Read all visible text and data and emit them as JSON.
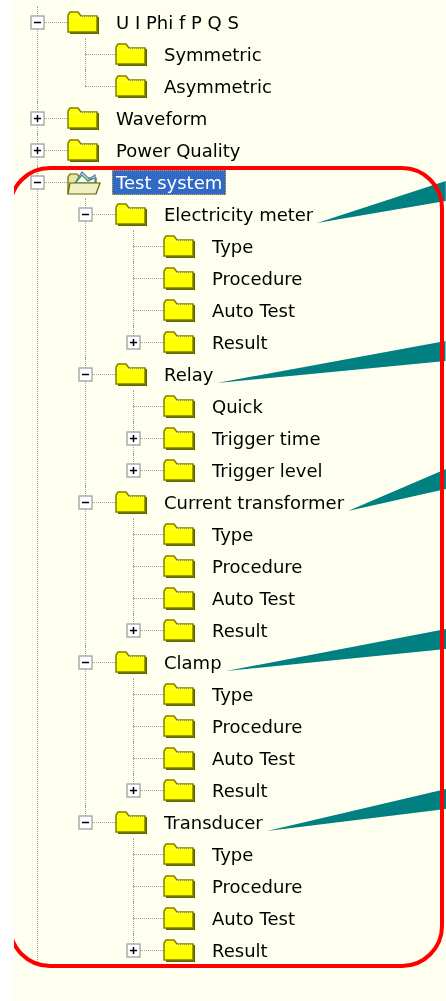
{
  "tree": [
    {
      "label": "U I Phi f P Q S",
      "kind": "folder",
      "selected": false,
      "expanded": true,
      "children": [
        {
          "label": "Symmetric",
          "kind": "folder",
          "selected": false
        },
        {
          "label": "Asymmetric",
          "kind": "folder",
          "selected": false
        }
      ]
    },
    {
      "label": "Waveform",
      "kind": "folder",
      "selected": false,
      "expanded": false
    },
    {
      "label": "Power Quality",
      "kind": "folder",
      "selected": false,
      "expanded": false
    },
    {
      "label": "Test system",
      "kind": "system",
      "selected": true,
      "expanded": true,
      "framed": true,
      "children": [
        {
          "label": "Electricity meter",
          "kind": "folder",
          "selected": false,
          "expanded": true,
          "pointer": true,
          "children": [
            {
              "label": "Type",
              "kind": "folder",
              "selected": false
            },
            {
              "label": "Procedure",
              "kind": "folder",
              "selected": false
            },
            {
              "label": "Auto Test",
              "kind": "folder",
              "selected": false
            },
            {
              "label": "Result",
              "kind": "folder",
              "selected": false,
              "expanded": false
            }
          ]
        },
        {
          "label": "Relay",
          "kind": "folder",
          "selected": false,
          "expanded": true,
          "pointer": true,
          "children": [
            {
              "label": "Quick",
              "kind": "folder",
              "selected": false
            },
            {
              "label": "Trigger time",
              "kind": "folder",
              "selected": false,
              "expanded": false
            },
            {
              "label": "Trigger level",
              "kind": "folder",
              "selected": false,
              "expanded": false
            }
          ]
        },
        {
          "label": "Current transformer",
          "kind": "folder",
          "selected": false,
          "expanded": true,
          "pointer": true,
          "children": [
            {
              "label": "Type",
              "kind": "folder",
              "selected": false
            },
            {
              "label": "Procedure",
              "kind": "folder",
              "selected": false
            },
            {
              "label": "Auto Test",
              "kind": "folder",
              "selected": false
            },
            {
              "label": "Result",
              "kind": "folder",
              "selected": false,
              "expanded": false
            }
          ]
        },
        {
          "label": "Clamp",
          "kind": "folder",
          "selected": false,
          "expanded": true,
          "pointer": true,
          "children": [
            {
              "label": "Type",
              "kind": "folder",
              "selected": false
            },
            {
              "label": "Procedure",
              "kind": "folder",
              "selected": false
            },
            {
              "label": "Auto Test",
              "kind": "folder",
              "selected": false
            },
            {
              "label": "Result",
              "kind": "folder",
              "selected": false,
              "expanded": false
            }
          ]
        },
        {
          "label": "Transducer",
          "kind": "folder",
          "selected": false,
          "expanded": true,
          "pointer": true,
          "children": [
            {
              "label": "Type",
              "kind": "folder",
              "selected": false
            },
            {
              "label": "Procedure",
              "kind": "folder",
              "selected": false
            },
            {
              "label": "Auto Test",
              "kind": "folder",
              "selected": false
            },
            {
              "label": "Result",
              "kind": "folder",
              "selected": false,
              "expanded": false
            }
          ]
        }
      ]
    }
  ]
}
